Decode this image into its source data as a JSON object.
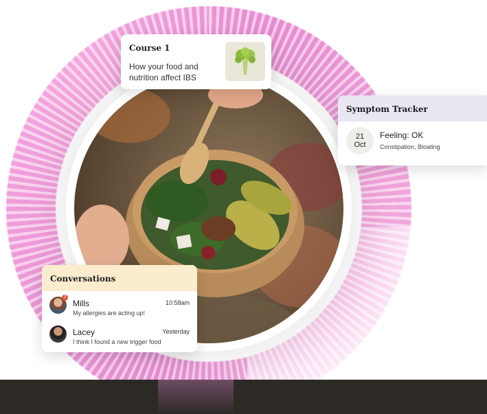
{
  "course": {
    "kicker": "Course 1",
    "title": "How your food and nutrition affect IBS",
    "thumbnail_icon": "broccoli-icon"
  },
  "symptom_tracker": {
    "header": "Symptom Tracker",
    "date_day": "21",
    "date_month": "Oct",
    "feeling": "Feeling: OK",
    "symptoms": "Constipation, Bloating"
  },
  "conversations": {
    "header": "Conversations",
    "items": [
      {
        "name": "Mills",
        "time": "10:58am",
        "message": "My allergies are acting up!",
        "unread": "2"
      },
      {
        "name": "Lacey",
        "time": "Yesterday",
        "message": "I think I found a new trigger food"
      }
    ]
  },
  "colors": {
    "ring": "#e58bd0",
    "symptom_header": "#e8e7f2",
    "conversations_header": "#fbeccd",
    "badge": "#e2553c",
    "bottom_band": "#2d2a26"
  }
}
